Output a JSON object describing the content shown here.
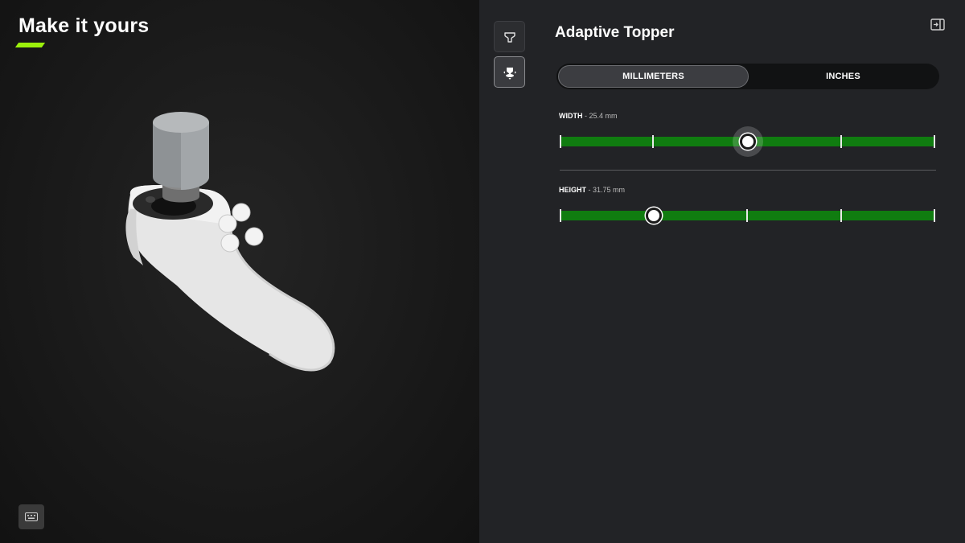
{
  "preview": {
    "title": "Make it yours",
    "accent_color": "#9bf00b",
    "keyboard_icon": "keyboard-icon"
  },
  "settings": {
    "nav_icons": [
      "topper-icon",
      "thumbstick-icon"
    ],
    "title": "Adaptive Topper",
    "exit_icon": "exit-panel-icon",
    "units": {
      "options": [
        "MILLIMETERS",
        "INCHES"
      ],
      "selected": "MILLIMETERS"
    },
    "width": {
      "label": "WIDTH",
      "value_text": " - 25.4 mm",
      "fraction": 0.5,
      "focused": true
    },
    "height": {
      "label": "HEIGHT",
      "value_text": " - 31.75 mm",
      "fraction": 0.25,
      "focused": false
    },
    "track_color": "#107c10"
  }
}
